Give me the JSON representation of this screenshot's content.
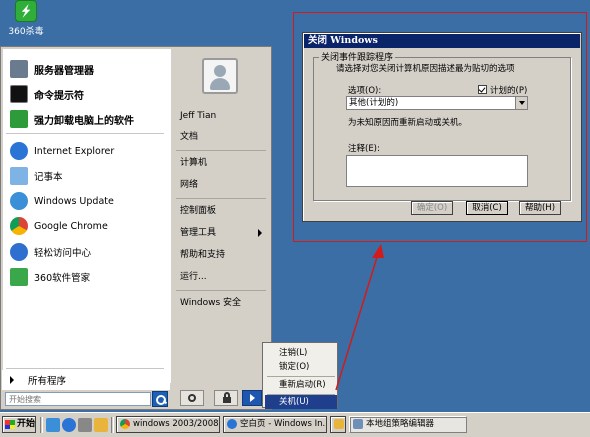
{
  "desktop": {
    "icon_label": "360杀毒"
  },
  "start_menu": {
    "pinned": [
      {
        "label": "服务器管理器"
      },
      {
        "label": "命令提示符"
      },
      {
        "label": "强力卸载电脑上的软件"
      }
    ],
    "recent": [
      {
        "label": "Internet Explorer"
      },
      {
        "label": "记事本"
      },
      {
        "label": "Windows Update"
      },
      {
        "label": "Google Chrome"
      },
      {
        "label": "轻松访问中心"
      },
      {
        "label": "360软件管家"
      }
    ],
    "all_programs": "所有程序",
    "search_placeholder": "开始搜索",
    "right": {
      "user": "Jeff Tian",
      "docs": "文档",
      "computer": "计算机",
      "network": "网络",
      "control_panel": "控制面板",
      "admin_tools": "管理工具",
      "help": "帮助和支持",
      "run": "运行...",
      "windows_security": "Windows 安全"
    },
    "power_submenu": {
      "logoff": "注销(L)",
      "lock": "锁定(O)",
      "restart": "重新启动(R)",
      "shutdown": "关机(U)"
    }
  },
  "dialog": {
    "title": "关闭 Windows",
    "group_title": "关闭事件跟踪程序",
    "prompt": "请选择对您关闭计算机原因描述最为贴切的选项",
    "option_label": "选项(O):",
    "planned_label": "计划的(P)",
    "planned_checked": true,
    "option_value": "其他(计划的)",
    "option_desc": "为未知原因而重新启动或关机。",
    "comment_label": "注释(E):",
    "comment_value": "",
    "buttons": {
      "ok": "确定(O)",
      "cancel": "取消(C)",
      "help": "帮助(H)"
    }
  },
  "taskbar": {
    "start": "开始",
    "tasks": [
      {
        "label": "windows 2003/2008 ..."
      },
      {
        "label": "空白页 - Windows In..."
      },
      {
        "label": ""
      },
      {
        "label": "本地组策略编辑器"
      }
    ]
  },
  "colors": {
    "highlight_frame": "#d21b1b",
    "titlebar": "#0a246a",
    "desktop": "#3a6ea5"
  }
}
